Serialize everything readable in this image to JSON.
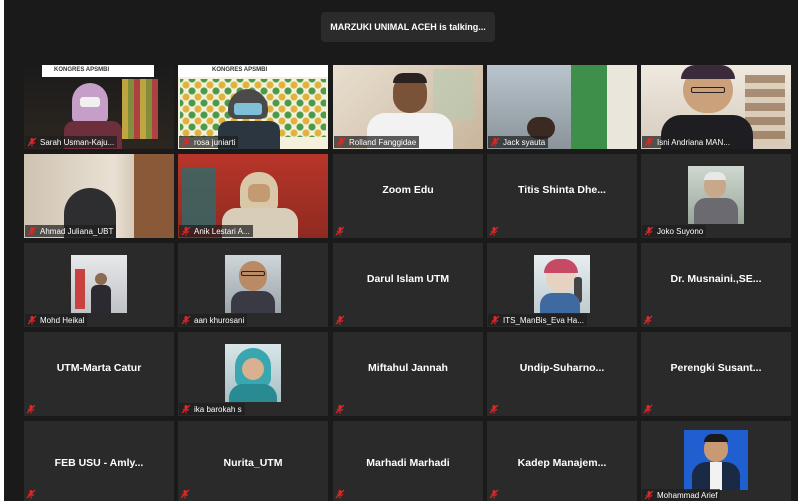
{
  "meeting": {
    "talking_banner": "MARZUKI UNIMAL ACEH is talking..."
  },
  "participants": [
    {
      "name": "Sarah Usman-Kaju...",
      "mode": "video"
    },
    {
      "name": "rosa juniarti",
      "mode": "video"
    },
    {
      "name": "Rolland Fanggidae",
      "mode": "video"
    },
    {
      "name": "Jack syauta",
      "mode": "video"
    },
    {
      "name": "Isni Andriana MAN...",
      "mode": "video"
    },
    {
      "name": "Ahmad Juliana_UBT",
      "mode": "video"
    },
    {
      "name": "Anik Lestari A...",
      "mode": "video"
    },
    {
      "name": "Zoom Edu",
      "mode": "name"
    },
    {
      "name": "Titis Shinta Dhe...",
      "mode": "name"
    },
    {
      "name": "Joko Suyono",
      "mode": "photo"
    },
    {
      "name": "Mohd Heikal",
      "mode": "photo"
    },
    {
      "name": "aan khurosani",
      "mode": "photo"
    },
    {
      "name": "Darul Islam UTM",
      "mode": "name"
    },
    {
      "name": "ITS_ManBis_Eva Ha...",
      "mode": "photo"
    },
    {
      "name": "Dr. Musnaini.,SE...",
      "mode": "name"
    },
    {
      "name": "UTM-Marta Catur",
      "mode": "name"
    },
    {
      "name": "ika barokah s",
      "mode": "photo"
    },
    {
      "name": "Miftahul Jannah",
      "mode": "name"
    },
    {
      "name": "Undip-Suharno...",
      "mode": "name"
    },
    {
      "name": "Perengki Susant...",
      "mode": "name"
    },
    {
      "name": "FEB USU - Amly...",
      "mode": "name"
    },
    {
      "name": "Nurita_UTM",
      "mode": "name"
    },
    {
      "name": "Marhadi Marhadi",
      "mode": "name"
    },
    {
      "name": "Kadep Manajem...",
      "mode": "name"
    },
    {
      "name": "Mohammad Arief",
      "mode": "photo"
    }
  ],
  "banners": {
    "kongres_1": "KONGRES APSMBI",
    "kongres_2": "KONGRES APSMBI"
  },
  "colors": {
    "mute_red": "#e02828",
    "window_bg": "#1a1a1a",
    "tile_bg": "#2a2a2a"
  }
}
